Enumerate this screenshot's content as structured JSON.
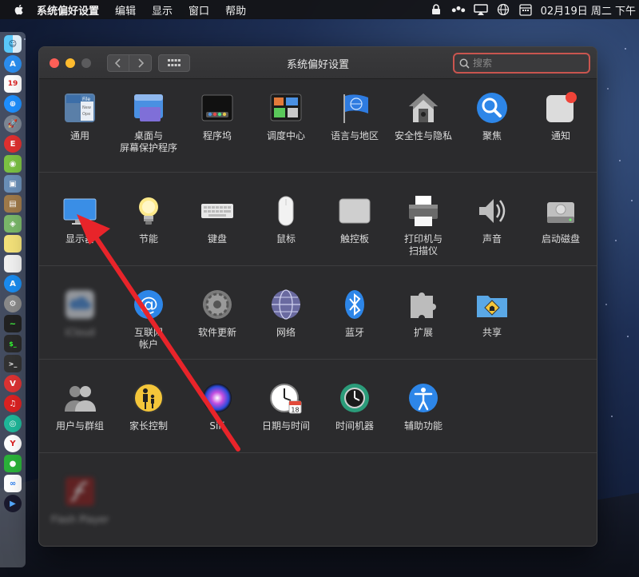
{
  "menubar": {
    "app_name": "系统偏好设置",
    "items": [
      "编辑",
      "显示",
      "窗口",
      "帮助"
    ],
    "clock": "02月19日 周二 下午"
  },
  "window": {
    "title": "系统偏好设置",
    "search_placeholder": "搜索"
  },
  "sections": [
    [
      {
        "label": "通用",
        "icon": "general-icon"
      },
      {
        "label": "桌面与\n屏幕保护程序",
        "icon": "desktop-screensaver-icon"
      },
      {
        "label": "程序坞",
        "icon": "dock-icon"
      },
      {
        "label": "调度中心",
        "icon": "mission-control-icon"
      },
      {
        "label": "语言与地区",
        "icon": "language-region-icon"
      },
      {
        "label": "安全性与隐私",
        "icon": "security-privacy-icon"
      },
      {
        "label": "聚焦",
        "icon": "spotlight-icon"
      },
      {
        "label": "通知",
        "icon": "notifications-icon"
      }
    ],
    [
      {
        "label": "显示器",
        "icon": "displays-icon"
      },
      {
        "label": "节能",
        "icon": "energy-saver-icon"
      },
      {
        "label": "键盘",
        "icon": "keyboard-icon"
      },
      {
        "label": "鼠标",
        "icon": "mouse-icon"
      },
      {
        "label": "触控板",
        "icon": "trackpad-icon"
      },
      {
        "label": "打印机与\n扫描仪",
        "icon": "printer-scanner-icon"
      },
      {
        "label": "声音",
        "icon": "sound-icon"
      },
      {
        "label": "启动磁盘",
        "icon": "startup-disk-icon"
      }
    ],
    [
      {
        "label": "iCloud",
        "icon": "icloud-icon"
      },
      {
        "label": "互联网\n帐户",
        "icon": "internet-accounts-icon"
      },
      {
        "label": "软件更新",
        "icon": "software-update-icon"
      },
      {
        "label": "网络",
        "icon": "network-icon"
      },
      {
        "label": "蓝牙",
        "icon": "bluetooth-icon"
      },
      {
        "label": "扩展",
        "icon": "extensions-icon"
      },
      {
        "label": "共享",
        "icon": "sharing-icon"
      }
    ],
    [
      {
        "label": "用户与群组",
        "icon": "users-groups-icon"
      },
      {
        "label": "家长控制",
        "icon": "parental-controls-icon"
      },
      {
        "label": "Siri",
        "icon": "siri-icon"
      },
      {
        "label": "日期与时间",
        "icon": "date-time-icon"
      },
      {
        "label": "时间机器",
        "icon": "time-machine-icon"
      },
      {
        "label": "辅助功能",
        "icon": "accessibility-icon"
      }
    ],
    [
      {
        "label": "Flash Player",
        "icon": "flash-player-icon"
      }
    ]
  ],
  "calendar_day": "19",
  "date_time_day": "18",
  "colors": {
    "annotation_arrow": "#e8242a",
    "search_border": "#c9554f"
  }
}
